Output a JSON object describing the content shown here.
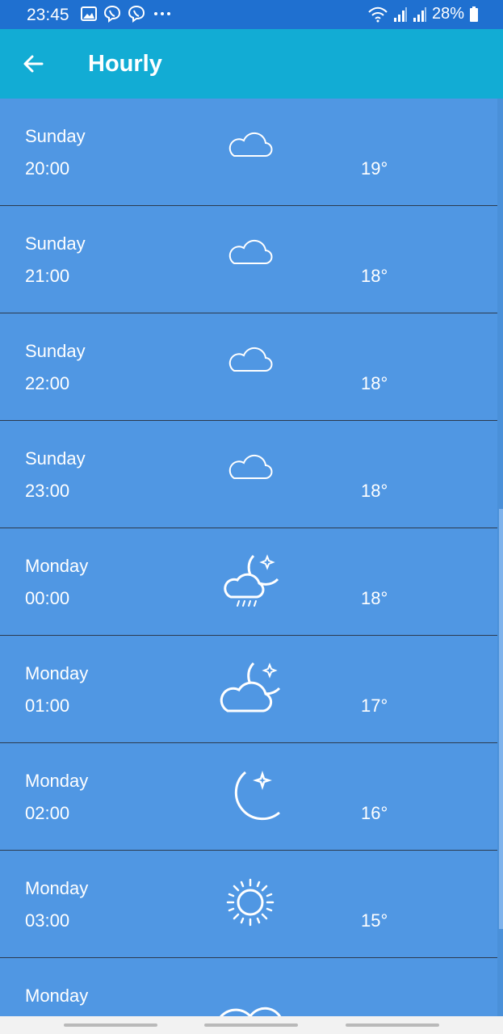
{
  "status_bar": {
    "time": "23:45",
    "battery": "28%",
    "left_icons": [
      "gallery-icon",
      "viber-icon",
      "viber-icon",
      "more-icon"
    ],
    "right_icons": [
      "wifi-icon",
      "signal-icon",
      "signal-icon",
      "battery-icon"
    ]
  },
  "header": {
    "title": "Hourly",
    "back_icon": "back-arrow-icon"
  },
  "hours": [
    {
      "day": "Sunday",
      "time": "20:00",
      "temp": "19°",
      "icon": "cloud-icon"
    },
    {
      "day": "Sunday",
      "time": "21:00",
      "temp": "18°",
      "icon": "cloud-icon"
    },
    {
      "day": "Sunday",
      "time": "22:00",
      "temp": "18°",
      "icon": "cloud-icon"
    },
    {
      "day": "Sunday",
      "time": "23:00",
      "temp": "18°",
      "icon": "cloud-icon"
    },
    {
      "day": "Monday",
      "time": "00:00",
      "temp": "18°",
      "icon": "night-rain-icon"
    },
    {
      "day": "Monday",
      "time": "01:00",
      "temp": "17°",
      "icon": "night-partly-cloudy-icon"
    },
    {
      "day": "Monday",
      "time": "02:00",
      "temp": "16°",
      "icon": "moon-icon"
    },
    {
      "day": "Monday",
      "time": "03:00",
      "temp": "15°",
      "icon": "sun-icon"
    },
    {
      "day": "Monday",
      "time": "",
      "temp": "",
      "icon": "cloudy-icon"
    }
  ],
  "colors": {
    "status_bar": "#1f70d0",
    "app_bar": "#12acd4",
    "row_background": "#5097e3"
  }
}
